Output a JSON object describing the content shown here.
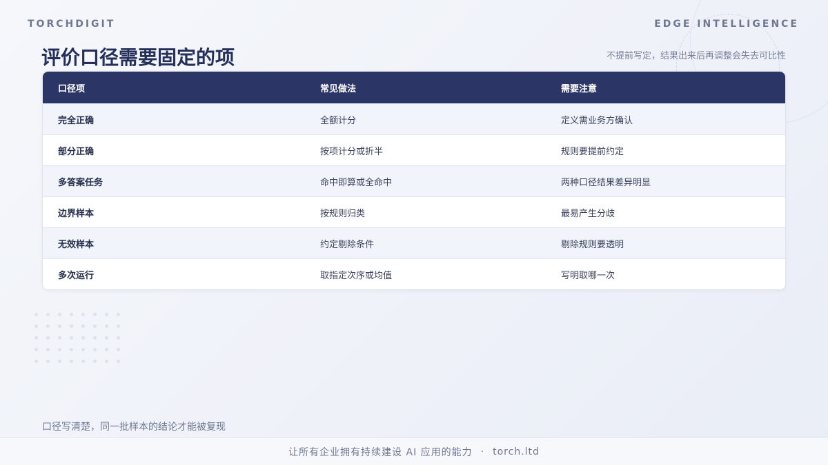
{
  "header": {
    "brand": "TORCHDIGIT",
    "tagline": "EDGE INTELLIGENCE"
  },
  "title": "评价口径需要固定的项",
  "subtitle": "不提前写定，结果出来后再调整会失去可比性",
  "table": {
    "columns": [
      "口径项",
      "常见做法",
      "需要注意"
    ],
    "rows": [
      [
        "完全正确",
        "全额计分",
        "定义需业务方确认"
      ],
      [
        "部分正确",
        "按项计分或折半",
        "规则要提前约定"
      ],
      [
        "多答案任务",
        "命中即算或全命中",
        "两种口径结果差异明显"
      ],
      [
        "边界样本",
        "按规则归类",
        "最易产生分歧"
      ],
      [
        "无效样本",
        "约定剔除条件",
        "剔除规则要透明"
      ],
      [
        "多次运行",
        "取指定次序或均值",
        "写明取哪一次"
      ]
    ]
  },
  "footnote": "口径写清楚，同一批样本的结论才能被复现",
  "footer": {
    "slogan": "让所有企业拥有持续建设 AI 应用的能力",
    "separator": "·",
    "site": "torch.ltd"
  }
}
